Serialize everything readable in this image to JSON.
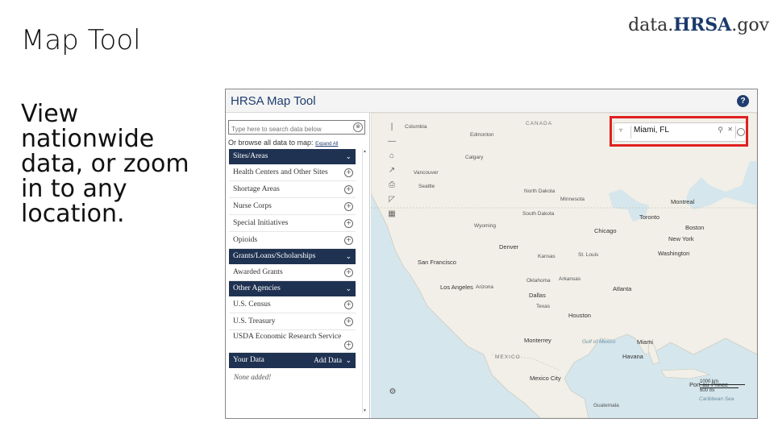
{
  "slide": {
    "title": "Map Tool",
    "description": "View nationwide data, or zoom in to any location.",
    "brand_prefix": "data.",
    "brand_mid": "HRSA",
    "brand_suffix": ".gov"
  },
  "app": {
    "title": "HRSA  Map Tool",
    "help": "?"
  },
  "sidebar": {
    "search_placeholder": "Type here to search data below",
    "clear": "⊗",
    "browse_text": "Or browse all data to map:",
    "browse_link": "Expand All",
    "sites_header": "Sites/Areas",
    "sites_items": [
      "Health Centers and Other Sites",
      "Shortage Areas",
      "Nurse Corps",
      "Special Initiatives",
      "Opioids"
    ],
    "grants_header": "Grants/Loans/Scholarships",
    "grants_items": [
      "Awarded Grants"
    ],
    "agencies_header": "Other Agencies",
    "agencies_items": [
      "U.S. Census",
      "U.S. Treasury",
      "USDA Economic Research Service"
    ],
    "yourdata_header": "Your Data",
    "add_data": "Add Data",
    "none_added": "None added!"
  },
  "map_search": {
    "value": "Miami, FL"
  },
  "map_labels": {
    "edmonton": "Edmonton",
    "calgary": "Calgary",
    "vancouver": "Vancouver",
    "seattle": "Seattle",
    "canada": "CANADA",
    "columbia": "Columbia",
    "toronto": "Toronto",
    "montreal": "Montreal",
    "boston": "Boston",
    "newyork": "New York",
    "chicago": "Chicago",
    "washington": "Washington",
    "denver": "Denver",
    "stlouis": "St. Louis",
    "sanfrancisco": "San Francisco",
    "losangeles": "Los Angeles",
    "dallas": "Dallas",
    "atlanta": "Atlanta",
    "houston": "Houston",
    "monterrey": "Monterrey",
    "miami": "Miami",
    "havana": "Havana",
    "mexicocity": "Mexico City",
    "guatemala": "Guatemala",
    "portauprince": "Port-au-Prince",
    "gulf": "Gulf of Mexico",
    "caribbean": "Caribbean Sea",
    "ndakota": "North Dakota",
    "sdakota": "South Dakota",
    "minnesota": "Minnesota",
    "wyoming": "Wyoming",
    "kansas": "Kansas",
    "oklahoma": "Oklahoma",
    "texas": "Texas",
    "arizona": "Arizona",
    "arkansas": "Arkansas",
    "mexico": "MEXICO"
  },
  "scale": {
    "km": "1000 km",
    "mi": "600 mi"
  }
}
